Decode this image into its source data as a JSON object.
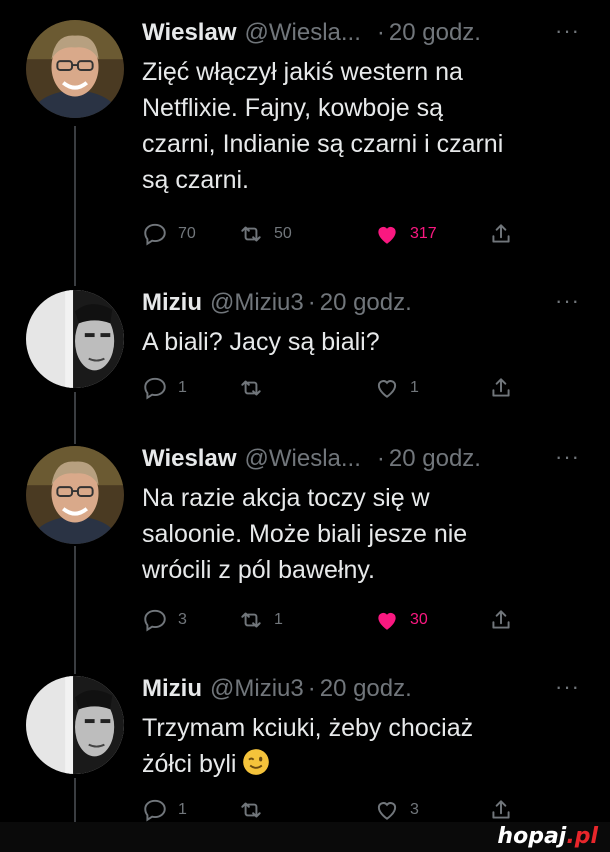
{
  "tweets": [
    {
      "name": "Wieslaw",
      "handle": "@Wiesla...",
      "sep": "·",
      "time": "20 godz.",
      "more": "···",
      "text": "Zięć włączył jakiś western na\nNetflixie. Fajny, kowboje są\nczarni, Indianie są czarni i czarni\nsą czarni.",
      "replies": "70",
      "retweets": "50",
      "likes": "317",
      "liked": true
    },
    {
      "name": "Miziu",
      "handle": "@Miziu3",
      "sep": "·",
      "time": "20 godz.",
      "more": "···",
      "text": "A biali? Jacy są biali?",
      "replies": "1",
      "retweets": "",
      "likes": "1",
      "liked": false
    },
    {
      "name": "Wieslaw",
      "handle": "@Wiesla...",
      "sep": "·",
      "time": "20 godz.",
      "more": "···",
      "text": "Na razie akcja toczy się w\nsaloonie. Może biali jesze nie\nwrócili z pól bawełny.",
      "replies": "3",
      "retweets": "1",
      "likes": "30",
      "liked": true
    },
    {
      "name": "Miziu",
      "handle": "@Miziu3",
      "sep": "·",
      "time": "20 godz.",
      "more": "···",
      "text": "Trzymam kciuki, żeby chociaż\nżółci byli",
      "emoji": "winking-face",
      "replies": "1",
      "retweets": "",
      "likes": "3",
      "liked": false
    }
  ],
  "watermark": {
    "brand": "hopaj",
    "suffix": ".pl"
  },
  "colors": {
    "background": "#000000",
    "text": "#e7e9ea",
    "muted": "#71767b",
    "like": "#f91880"
  }
}
